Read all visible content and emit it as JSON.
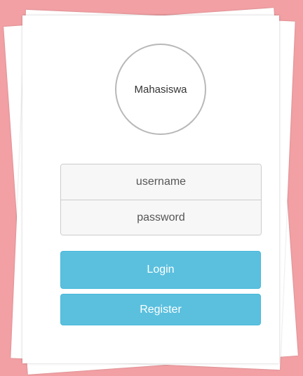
{
  "avatar": {
    "label": "Mahasiswa"
  },
  "form": {
    "username_placeholder": "username",
    "username_value": "",
    "password_placeholder": "password",
    "password_value": ""
  },
  "buttons": {
    "login_label": "Login",
    "register_label": "Register"
  },
  "colors": {
    "background": "#f2a0a4",
    "button": "#5bc0de",
    "button_text": "#ffffff"
  }
}
